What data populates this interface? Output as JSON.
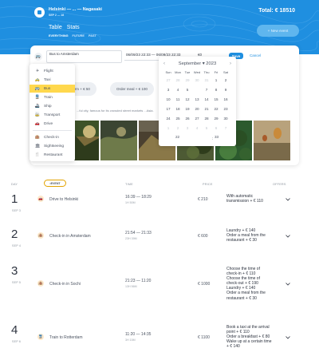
{
  "header": {
    "route": "Helsinki — ... — Nagasaki",
    "dates": "SEP 2 — 18",
    "total": "Total: € 18510",
    "tabs": [
      "Table",
      "Stats"
    ],
    "subtabs": [
      "EVERYTHING",
      "FUTURE",
      "PAST"
    ],
    "new_event_label": "+ New event",
    "brand_color": "#1f8fe0"
  },
  "editor": {
    "type_icon": "bus-icon",
    "title_value": "Bus to Amsterdam",
    "datetime_value": "06/09/23 22:33 — 06/09/23 22:33",
    "price_value": "€0",
    "save_label": "Save",
    "cancel_label": "Cancel",
    "offer_1": "...rm + € 50",
    "offer_2": "Order meal + € 100",
    "description": "...ful city, famous for its crowded street markets ...Asia."
  },
  "type_menu": {
    "selected": "Bus",
    "group_transport": [
      {
        "label": "Flight",
        "icon": "plane-icon"
      },
      {
        "label": "Taxi",
        "icon": "taxi-icon"
      },
      {
        "label": "Bus",
        "icon": "bus-icon"
      },
      {
        "label": "Train",
        "icon": "train-icon"
      },
      {
        "label": "Ship",
        "icon": "ship-icon"
      },
      {
        "label": "Transport",
        "icon": "transport-icon"
      },
      {
        "label": "Drive",
        "icon": "car-icon"
      }
    ],
    "group_stay": [
      {
        "label": "Check-in",
        "icon": "check-in-icon"
      },
      {
        "label": "Sightseeing",
        "icon": "sightseeing-icon"
      },
      {
        "label": "Restaurant",
        "icon": "restaurant-icon"
      }
    ]
  },
  "calendar": {
    "month": "September",
    "year": "2023",
    "weekdays": [
      "Sun",
      "Mon",
      "Tue",
      "Wed",
      "Thu",
      "Fri",
      "Sat"
    ],
    "days": [
      [
        "27",
        "28",
        "29",
        "30",
        "31",
        "1",
        "2"
      ],
      [
        "3",
        "4",
        "5",
        "6",
        "7",
        "8",
        "9"
      ],
      [
        "10",
        "11",
        "12",
        "13",
        "14",
        "15",
        "16"
      ],
      [
        "17",
        "18",
        "19",
        "20",
        "21",
        "22",
        "23"
      ],
      [
        "24",
        "25",
        "26",
        "27",
        "28",
        "29",
        "30"
      ],
      [
        "1",
        "2",
        "3",
        "4",
        "5",
        "6",
        "7"
      ]
    ],
    "muted_days": [
      "0-0",
      "0-1",
      "0-2",
      "0-3",
      "0-4",
      "5-0",
      "5-1",
      "5-2",
      "5-3",
      "5-4",
      "5-5",
      "5-6"
    ],
    "selected_day": "6",
    "hour": "22",
    "minute": "33",
    "time_sep": ":"
  },
  "table": {
    "headers": {
      "day": "DAY",
      "event": "EVENT",
      "time": "TIME",
      "price": "PRICE",
      "offers": "OFFERS"
    },
    "rows": [
      {
        "day": "1",
        "date": "SEP 3",
        "icon": "car-icon",
        "name": "Drive to Helsinki",
        "time": "16:39 — 18:29",
        "duration": "1H 50M",
        "price": "€ 210",
        "offers": [
          "With automatic",
          "transmission + € 110"
        ]
      },
      {
        "day": "2",
        "date": "SEP 4",
        "icon": "check-in-icon",
        "name": "Check-in in Amsterdam",
        "time": "21:54 — 21:33",
        "duration": "23H 39M",
        "price": "€ 600",
        "offers": [
          "Laundry + € 140",
          "Order a meal from the",
          "restaurant + € 30"
        ]
      },
      {
        "day": "3",
        "date": "SEP 5",
        "icon": "check-in-icon",
        "name": "Check-in in Sochi",
        "time": "21:23 — 11:20",
        "duration": "13H 56M",
        "price": "€ 1000",
        "offers": [
          "Choose the time of",
          "check-in + € 110",
          "Choose the time of",
          "check-out + € 190",
          "Laundry + € 140",
          "Order a meal from the",
          "restaurant + € 30"
        ]
      },
      {
        "day": "4",
        "date": "SEP 6",
        "icon": "train-icon",
        "name": "Train to Rotterdam",
        "time": "11:20 — 14:35",
        "duration": "3H 15M",
        "price": "€ 1100",
        "offers": [
          "Book a taxi at the arrival",
          "point + € 110",
          "Order a breakfast + € 80",
          "Wake up at a certain time",
          "+ € 140"
        ]
      }
    ]
  }
}
